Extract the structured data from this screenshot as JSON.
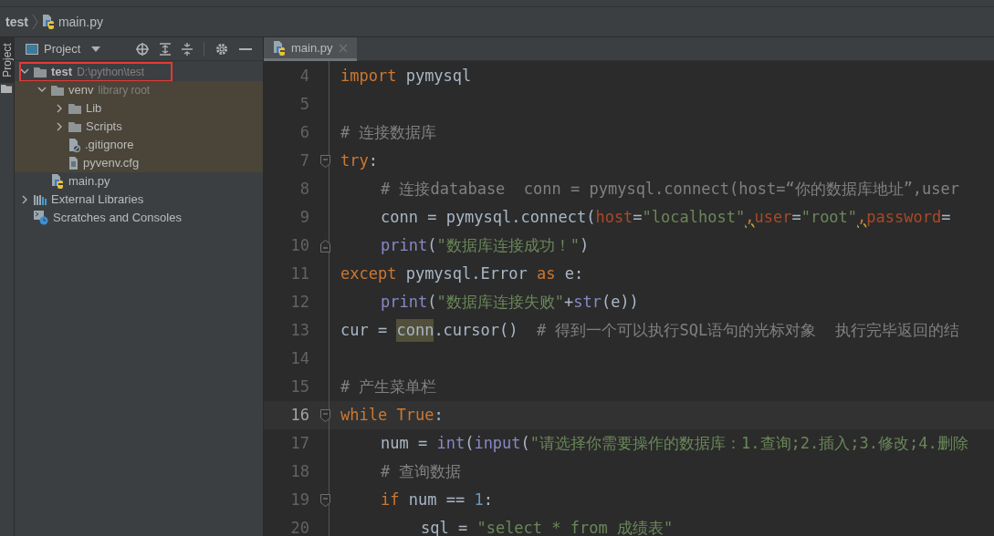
{
  "breadcrumb": [
    {
      "label": "test",
      "kind": "project"
    },
    {
      "label": "main.py",
      "kind": "python"
    }
  ],
  "side_stripe": {
    "tab": {
      "label": "Project",
      "selected": true
    }
  },
  "project_panel": {
    "title": "Project",
    "tree": [
      {
        "label": "test",
        "hint": "D:\\python\\test",
        "kind": "folder",
        "expanded": true,
        "annotated": true,
        "children": [
          {
            "label": "venv",
            "hint": "library root",
            "kind": "folder",
            "expanded": true,
            "tinted": true,
            "children": [
              {
                "label": "Lib",
                "kind": "folder",
                "expanded": false
              },
              {
                "label": "Scripts",
                "kind": "folder",
                "expanded": false
              },
              {
                "label": ".gitignore",
                "kind": "ignore"
              },
              {
                "label": "pyvenv.cfg",
                "kind": "text"
              }
            ]
          },
          {
            "label": "main.py",
            "kind": "python"
          }
        ]
      },
      {
        "label": "External Libraries",
        "kind": "libraries",
        "expanded": false
      },
      {
        "label": "Scratches and Consoles",
        "kind": "scratches"
      }
    ]
  },
  "editor": {
    "tabs": [
      {
        "label": "main.py",
        "selected": true
      }
    ],
    "lines": [
      {
        "no": "4",
        "kind": "top",
        "tokens": [
          {
            "kind": "kw",
            "text": "import"
          },
          {
            "kind": "plain",
            "text": " pymysql"
          }
        ]
      },
      {
        "no": "5"
      },
      {
        "no": "6",
        "kind": "top",
        "tokens": [
          {
            "kind": "comment",
            "text": "# 连接数据库"
          }
        ]
      },
      {
        "no": "7",
        "kind": "top",
        "fold_start": true,
        "tokens": [
          {
            "kind": "kw",
            "text": "try"
          },
          {
            "kind": "plain",
            "text": ":"
          }
        ]
      },
      {
        "no": "8",
        "kind": "body",
        "tokens": [
          {
            "kind": "comment",
            "text": "# 连接database  conn = pymysql.connect(host=“你的数据库地址”,user"
          }
        ]
      },
      {
        "no": "9",
        "kind": "body",
        "tokens": [
          {
            "kind": "plain",
            "text": "conn = pymysql.connect("
          },
          {
            "kind": "param",
            "text": "host"
          },
          {
            "kind": "plain",
            "text": "="
          },
          {
            "kind": "str",
            "text": "\"localhost\""
          },
          {
            "kind": "warn",
            "text": ","
          },
          {
            "kind": "param",
            "text": "user"
          },
          {
            "kind": "plain",
            "text": "="
          },
          {
            "kind": "str",
            "text": "\"root\""
          },
          {
            "kind": "warn",
            "text": ","
          },
          {
            "kind": "param",
            "text": "password"
          },
          {
            "kind": "plain",
            "text": "="
          }
        ]
      },
      {
        "no": "10",
        "kind": "body",
        "fold_end": true,
        "tokens": [
          {
            "kind": "builtin",
            "text": "print"
          },
          {
            "kind": "plain",
            "text": "("
          },
          {
            "kind": "str",
            "text": "\"数据库连接成功！\""
          },
          {
            "kind": "plain",
            "text": ")"
          }
        ]
      },
      {
        "no": "11",
        "kind": "top",
        "tokens": [
          {
            "kind": "kw",
            "text": "except"
          },
          {
            "kind": "plain",
            "text": " pymysql.Error "
          },
          {
            "kind": "kw",
            "text": "as"
          },
          {
            "kind": "plain",
            "text": " e:"
          }
        ]
      },
      {
        "no": "12",
        "kind": "body",
        "tokens": [
          {
            "kind": "builtin",
            "text": "print"
          },
          {
            "kind": "plain",
            "text": "("
          },
          {
            "kind": "str",
            "text": "\"数据库连接失败\""
          },
          {
            "kind": "plain",
            "text": "+"
          },
          {
            "kind": "builtin",
            "text": "str"
          },
          {
            "kind": "plain",
            "text": "(e))"
          }
        ]
      },
      {
        "no": "13",
        "kind": "top",
        "tokens": [
          {
            "kind": "plain",
            "text": "cur ="
          },
          {
            "kind": "usage",
            "text": "conn"
          },
          {
            "kind": "plain",
            "text": ".cursor()"
          },
          {
            "kind": "comment",
            "text": "# 得到一个可以执行SQL语句的光标对象  执行完毕返回的结"
          }
        ]
      },
      {
        "no": "14"
      },
      {
        "no": "15",
        "kind": "top",
        "tokens": [
          {
            "kind": "comment",
            "text": "# 产生菜单栏"
          }
        ]
      },
      {
        "no": "16",
        "kind": "top",
        "fold_start": true,
        "current": true,
        "tokens": [
          {
            "kind": "kw",
            "text": "while"
          },
          {
            "kind": "kw",
            "text": "True"
          },
          {
            "kind": "plain",
            "text": ":"
          }
        ]
      },
      {
        "no": "17",
        "kind": "body",
        "tokens": [
          {
            "kind": "plain",
            "text": "num ="
          },
          {
            "kind": "builtin",
            "text": "int"
          },
          {
            "kind": "plain",
            "text": "("
          },
          {
            "kind": "builtin",
            "text": "input"
          },
          {
            "kind": "plain",
            "text": "("
          },
          {
            "kind": "str",
            "text": "\"请选择你需要操作的数据库：1.查询;2.插入;3.修改;4.删除"
          }
        ]
      },
      {
        "no": "18",
        "kind": "body",
        "tokens": [
          {
            "kind": "comment",
            "text": "# 查询数据"
          }
        ]
      },
      {
        "no": "19",
        "kind": "body",
        "fold_start": true,
        "tokens": [
          {
            "kind": "kw",
            "text": "if"
          },
          {
            "kind": "plain",
            "text": "num =="
          },
          {
            "kind": "num",
            "text": "1"
          },
          {
            "kind": "plain",
            "text": ":"
          }
        ]
      },
      {
        "no": "20",
        "kind": "nested",
        "tokens": [
          {
            "kind": "plain",
            "text": "sql ="
          },
          {
            "kind": "str",
            "text": "\"select * from 成绩表\""
          }
        ]
      }
    ]
  }
}
